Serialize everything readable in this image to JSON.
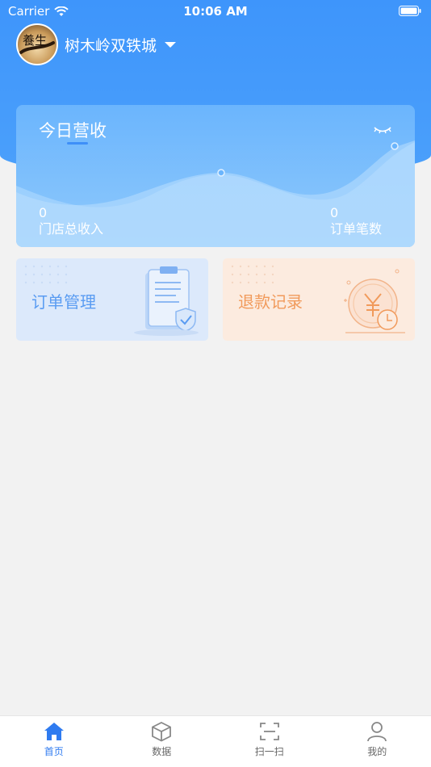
{
  "status_bar": {
    "carrier": "Carrier",
    "time": "10:06 AM"
  },
  "header": {
    "store_name": "树木岭双铁城",
    "avatar_text": "養生"
  },
  "revenue_card": {
    "title": "今日营收",
    "store_income_value": "0",
    "store_income_label": "门店总收入",
    "order_count_value": "0",
    "order_count_label": "订单笔数"
  },
  "tiles": {
    "orders_label": "订单管理",
    "refund_label": "退款记录"
  },
  "tabbar": {
    "items": [
      {
        "label": "首页",
        "icon": "home-icon",
        "active": true
      },
      {
        "label": "数据",
        "icon": "cube-icon",
        "active": false
      },
      {
        "label": "扫一扫",
        "icon": "scan-icon",
        "active": false
      },
      {
        "label": "我的",
        "icon": "user-icon",
        "active": false
      }
    ]
  },
  "colors": {
    "primary": "#3e95fb",
    "active_tab": "#2f7bf0",
    "orders_accent": "#5a9cf2",
    "refund_accent": "#f19a5b",
    "background": "#f2f2f2"
  }
}
